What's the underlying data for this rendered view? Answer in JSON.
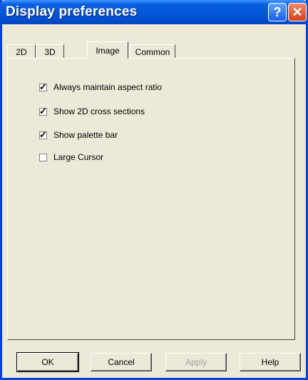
{
  "window": {
    "title": "Display preferences"
  },
  "title_buttons": {
    "help": "?",
    "close": "✕"
  },
  "tabs": [
    {
      "label": "2D",
      "active": false
    },
    {
      "label": "3D",
      "active": false
    },
    {
      "label": "Image",
      "active": true
    },
    {
      "label": "Common",
      "active": false
    }
  ],
  "options": [
    {
      "label": "Always maintain aspect ratio",
      "checked": true
    },
    {
      "label": "Show 2D cross sections",
      "checked": true
    },
    {
      "label": "Show palette bar",
      "checked": true
    },
    {
      "label": "Large Cursor",
      "checked": false
    }
  ],
  "buttons": {
    "ok": "OK",
    "cancel": "Cancel",
    "apply": "Apply",
    "help": "Help"
  }
}
